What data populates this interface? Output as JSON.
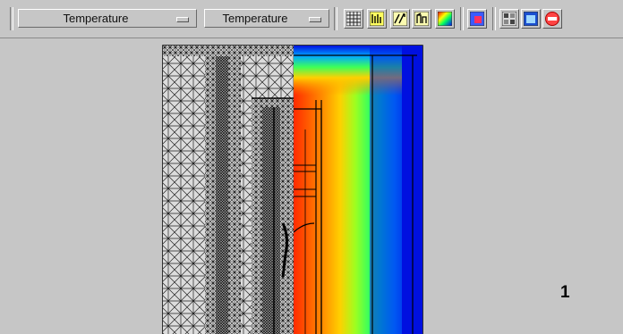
{
  "toolbar": {
    "dropdown_1": {
      "value": "Temperature"
    },
    "dropdown_2": {
      "value": "Temperature"
    },
    "tools": [
      {
        "icon": "mesh-view-icon"
      },
      {
        "icon": "contour-plot-icon"
      },
      {
        "icon": "vector-plot-icon"
      },
      {
        "icon": "streamline-icon"
      },
      {
        "icon": "color-map-icon"
      },
      {
        "icon": "select-region-icon"
      },
      {
        "icon": "layout-icon"
      },
      {
        "icon": "window-icon"
      },
      {
        "icon": "stop-icon"
      }
    ]
  },
  "colors": {
    "hot": "#ff2a00",
    "warm": "#ffd000",
    "mid": "#3cff5a",
    "cool": "#00c8ff",
    "cold": "#0010e0"
  },
  "panel": {
    "number": "1"
  }
}
